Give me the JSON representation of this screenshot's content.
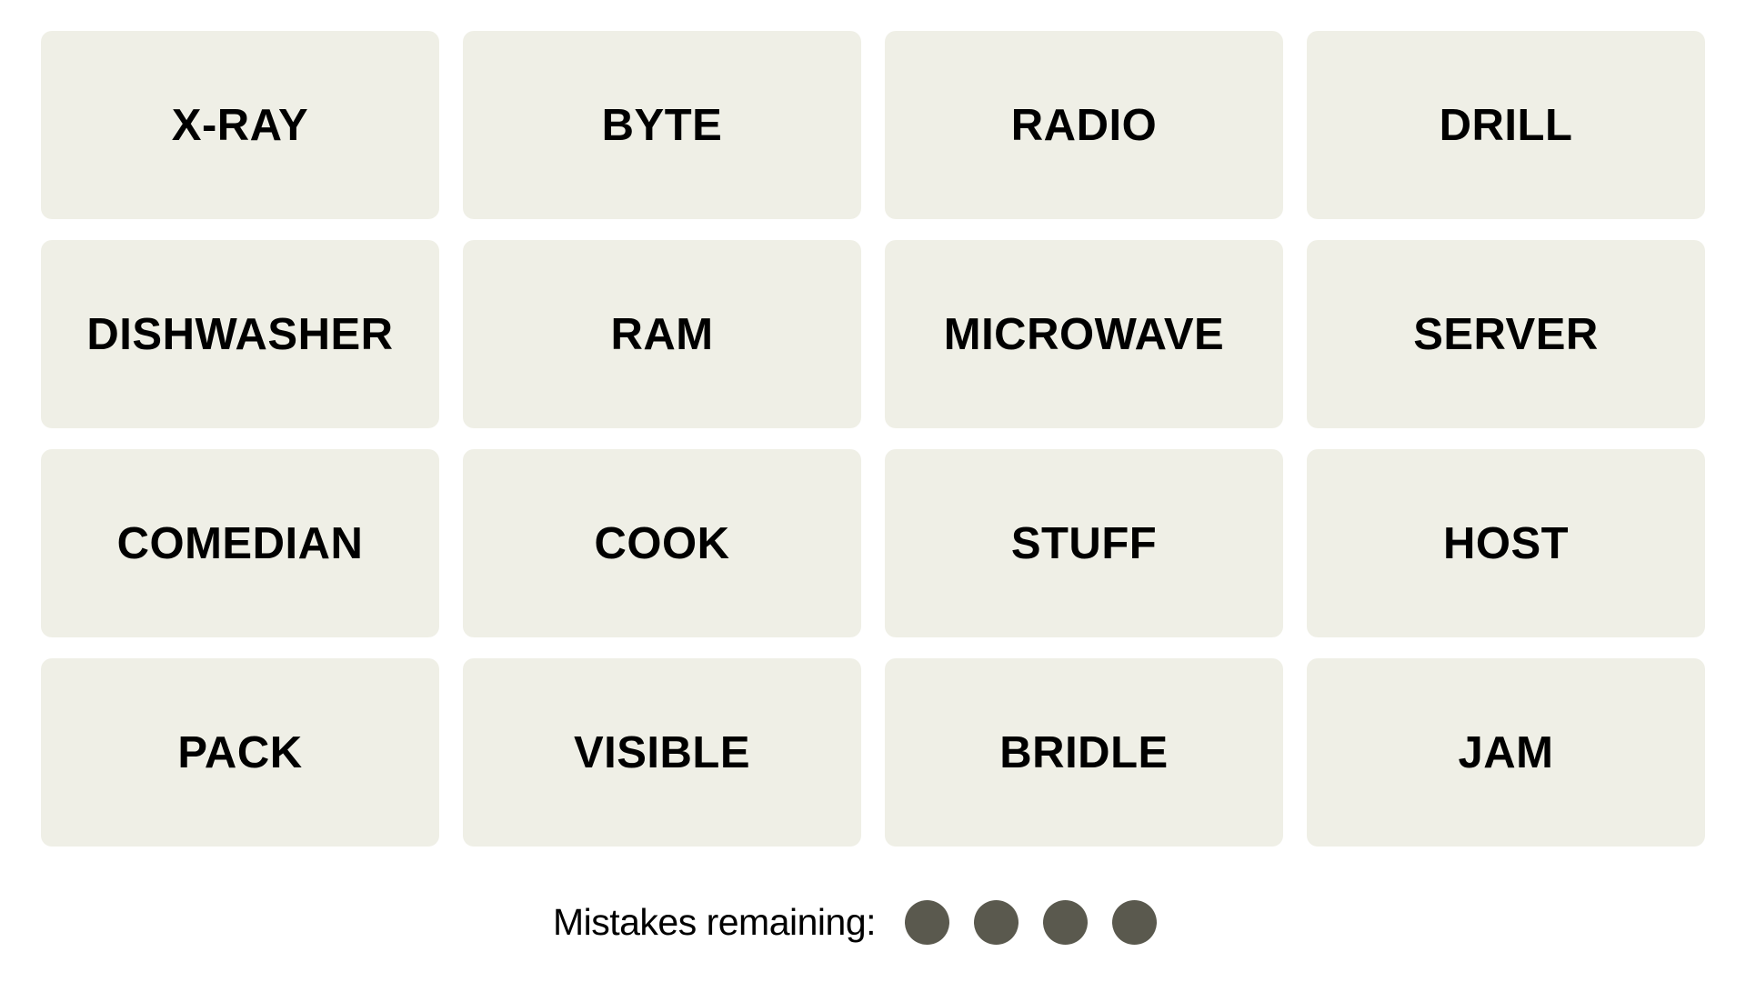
{
  "board": {
    "tiles": [
      "X-RAY",
      "BYTE",
      "RADIO",
      "DRILL",
      "DISHWASHER",
      "RAM",
      "MICROWAVE",
      "SERVER",
      "COMEDIAN",
      "COOK",
      "STUFF",
      "HOST",
      "PACK",
      "VISIBLE",
      "BRIDLE",
      "JAM"
    ]
  },
  "mistakes": {
    "label": "Mistakes remaining:",
    "remaining": 4,
    "total": 4,
    "dot_color": "#5a594e"
  },
  "colors": {
    "tile_background": "#efefe6",
    "tile_text": "#000000",
    "page_background": "#ffffff"
  }
}
